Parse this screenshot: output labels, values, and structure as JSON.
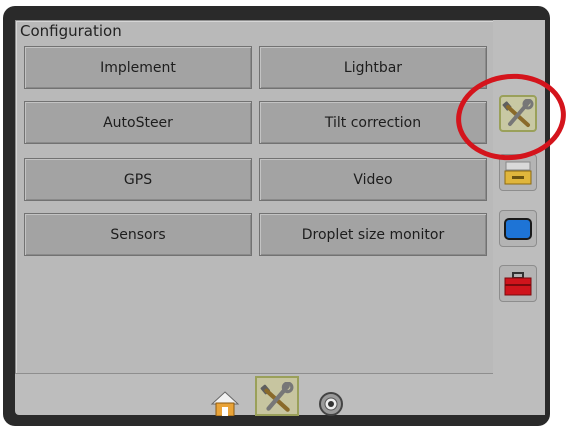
{
  "panel": {
    "title": "Configuration"
  },
  "buttons": {
    "implement": "Implement",
    "lightbar": "Lightbar",
    "autosteer": "AutoSteer",
    "tilt": "Tilt correction",
    "gps": "GPS",
    "video": "Video",
    "sensors": "Sensors",
    "droplet": "Droplet size monitor"
  },
  "side_tabs": [
    "tools-icon",
    "console-icon",
    "screen-icon",
    "toolbox-icon"
  ],
  "bottom_tabs": [
    "home-icon",
    "tools-icon",
    "camera-icon"
  ],
  "colors": {
    "active_highlight": "#9aa05a",
    "annotation_ring": "#d4141c",
    "toolbox_red": "#d0141c"
  }
}
